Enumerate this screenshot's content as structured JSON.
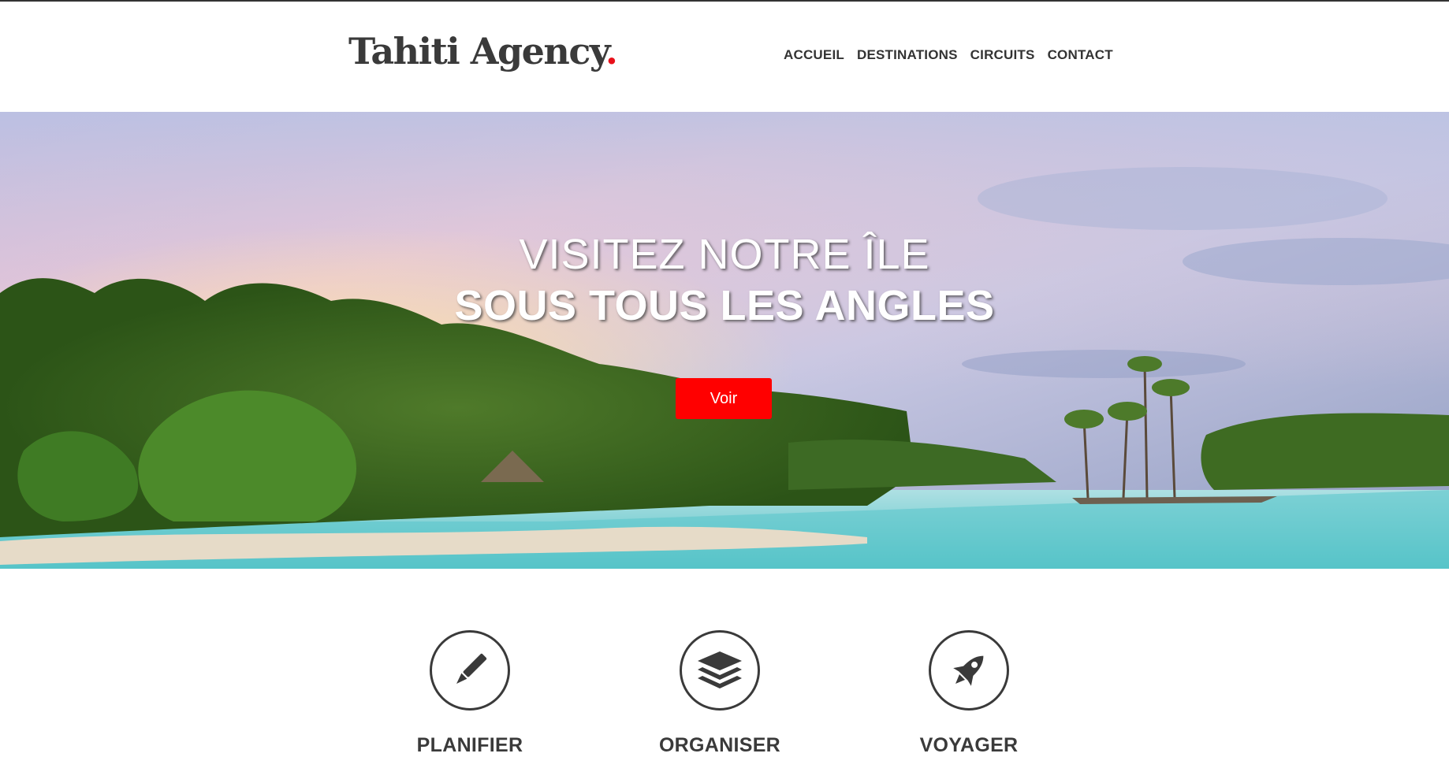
{
  "header": {
    "logo_text": "Tahiti Agency",
    "logo_dot": ".",
    "nav": [
      {
        "label": "ACCUEIL"
      },
      {
        "label": "DESTINATIONS"
      },
      {
        "label": "CIRCUITS"
      },
      {
        "label": "CONTACT"
      }
    ]
  },
  "hero": {
    "line1": "VISITEZ NOTRE ÎLE",
    "line2": "SOUS TOUS LES ANGLES",
    "cta_label": "Voir"
  },
  "features": [
    {
      "icon": "pen-icon",
      "title": "PLANIFIER"
    },
    {
      "icon": "layers-icon",
      "title": "ORGANISER"
    },
    {
      "icon": "rocket-icon",
      "title": "VOYAGER"
    }
  ],
  "colors": {
    "accent": "#ff0000",
    "logo_dot": "#e8101a",
    "text": "#333333"
  }
}
